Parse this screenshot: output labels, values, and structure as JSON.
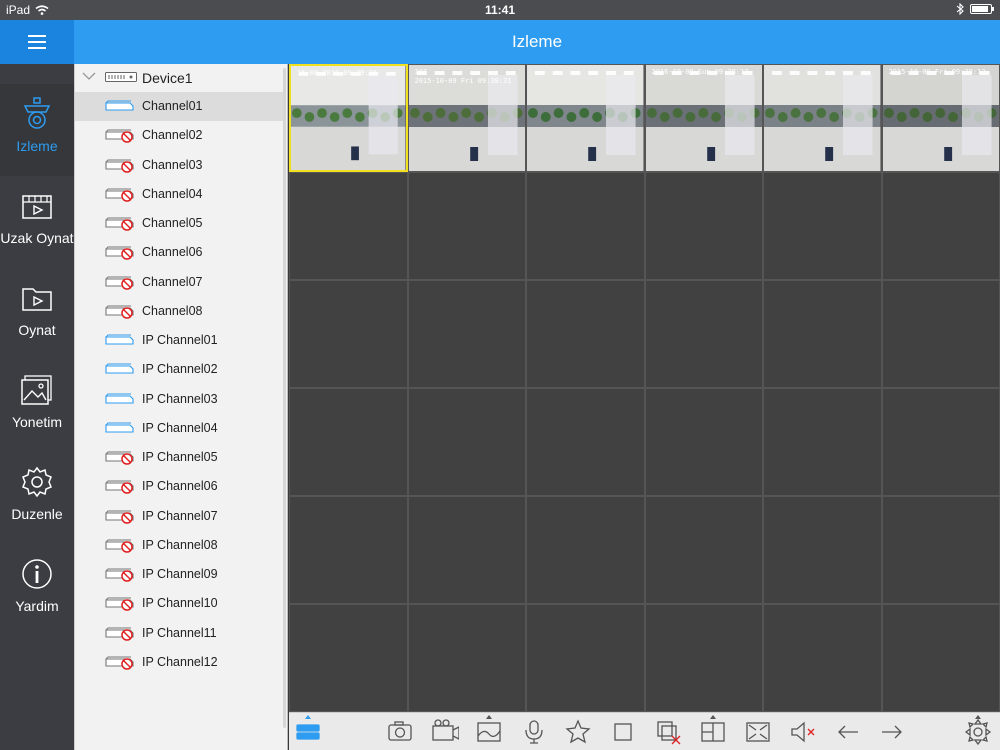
{
  "status_bar": {
    "device": "iPad",
    "time": "11:41"
  },
  "header": {
    "title": "Izleme"
  },
  "sidebar": {
    "items": [
      {
        "label": "Izleme",
        "icon": "camera-icon",
        "active": true
      },
      {
        "label": "Uzak Oynat",
        "icon": "remote-playback-icon",
        "active": false
      },
      {
        "label": "Oynat",
        "icon": "playback-folder-icon",
        "active": false
      },
      {
        "label": "Yonetim",
        "icon": "image-manage-icon",
        "active": false
      },
      {
        "label": "Duzenle",
        "icon": "gear-icon",
        "active": false
      },
      {
        "label": "Yardim",
        "icon": "info-icon",
        "active": false
      }
    ]
  },
  "tree": {
    "device": "Device1",
    "channels": [
      {
        "label": "Channel01",
        "online": true,
        "selected": true
      },
      {
        "label": "Channel02",
        "online": false
      },
      {
        "label": "Channel03",
        "online": false
      },
      {
        "label": "Channel04",
        "online": false
      },
      {
        "label": "Channel05",
        "online": false
      },
      {
        "label": "Channel06",
        "online": false
      },
      {
        "label": "Channel07",
        "online": false
      },
      {
        "label": "Channel08",
        "online": false
      },
      {
        "label": "IP Channel01",
        "online": true
      },
      {
        "label": "IP Channel02",
        "online": true
      },
      {
        "label": "IP Channel03",
        "online": true
      },
      {
        "label": "IP Channel04",
        "online": true
      },
      {
        "label": "IP Channel05",
        "online": false
      },
      {
        "label": "IP Channel06",
        "online": false
      },
      {
        "label": "IP Channel07",
        "online": false
      },
      {
        "label": "IP Channel08",
        "online": false
      },
      {
        "label": "IP Channel09",
        "online": false
      },
      {
        "label": "IP Channel10",
        "online": false
      },
      {
        "label": "IP Channel11",
        "online": false
      },
      {
        "label": "IP Channel12",
        "online": false
      }
    ]
  },
  "grid": {
    "rows": 6,
    "cols": 6,
    "live_feeds": [
      {
        "overlay": "15-08-2016 09:39:36"
      },
      {
        "overlay": "103\n2015-10-09 Fri 09:38:31"
      },
      {
        "overlay": ""
      },
      {
        "overlay": "2016-10-09 Sun 09:38:12"
      },
      {
        "overlay": ""
      },
      {
        "overlay": "2015-10-09 Fri 09:38:12"
      }
    ]
  },
  "toolbar": {
    "buttons": [
      "device-list-icon",
      "snapshot-icon",
      "record-icon",
      "image-quality-icon",
      "microphone-icon",
      "favorite-star-icon",
      "single-view-icon",
      "close-all-icon",
      "split-layout-icon",
      "fullscreen-icon",
      "mute-icon",
      "prev-page-icon",
      "next-page-icon",
      "ptz-icon"
    ]
  },
  "colors": {
    "accent": "#2e9cf0",
    "active_border": "#f0e020",
    "offline": "#e02020"
  }
}
